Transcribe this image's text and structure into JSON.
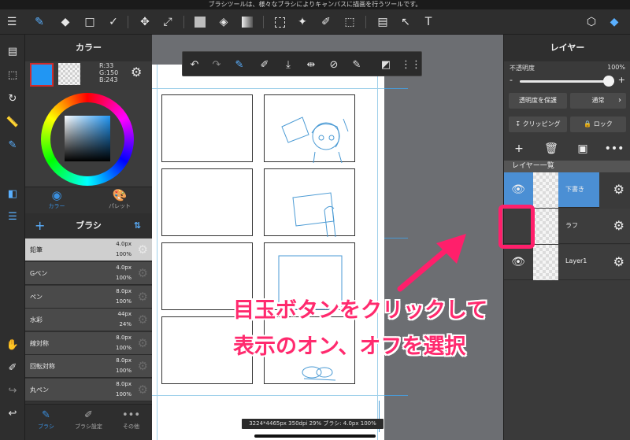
{
  "status_bar": {
    "text": "ブラシツールは、様々なブラシによりキャンバスに描画を行うツールです。"
  },
  "top_toolbar": {
    "tools": [
      "menu-icon",
      "brush-tool-icon",
      "eraser-tool-icon",
      "rectangle-tool-icon",
      "sparkle-tool-icon",
      "move-tool-icon",
      "transform-tool-icon",
      "fill-color-icon",
      "bucket-tool-icon",
      "gradient-tool-icon",
      "select-tool-icon",
      "magic-wand-icon",
      "select-pen-icon",
      "select-eraser-icon",
      "frame-divide-icon",
      "operation-tool-icon",
      "text-tool-icon",
      "material-icon",
      "layer-icon"
    ]
  },
  "color_panel": {
    "title": "カラー",
    "rgb": {
      "r": "R:33",
      "g": "G:150",
      "b": "B:243"
    },
    "main_color": "#2196f3",
    "tabs": [
      {
        "label": "カラー"
      },
      {
        "label": "パレット"
      }
    ]
  },
  "brush_panel": {
    "title": "ブラシ",
    "brushes": [
      {
        "name": "鉛筆",
        "size": "4.0px",
        "opacity": "100%"
      },
      {
        "name": "Gペン",
        "size": "4.0px",
        "opacity": "100%"
      },
      {
        "name": "ペン",
        "size": "8.0px",
        "opacity": "100%"
      },
      {
        "name": "水彩",
        "size": "44px",
        "opacity": "24%"
      },
      {
        "name": "線対称",
        "size": "8.0px",
        "opacity": "100%"
      },
      {
        "name": "回転対称",
        "size": "8.0px",
        "opacity": "100%"
      },
      {
        "name": "丸ペン",
        "size": "8.0px",
        "opacity": "100%"
      }
    ],
    "tabs": [
      {
        "label": "ブラシ"
      },
      {
        "label": "ブラシ設定"
      },
      {
        "label": "その他"
      }
    ]
  },
  "canvas": {
    "info": "3224*4465px 350dpi 29% ブラシ: 4.0px 100%"
  },
  "layer_panel": {
    "title": "レイヤー",
    "opacity_label": "不透明度",
    "opacity_value": "100%",
    "opacity": 1.0,
    "protect_alpha": "透明度を保護",
    "blend_mode": "通常",
    "clipping": "クリッピング",
    "lock": "ロック",
    "list_header": "レイヤー一覧",
    "layers": [
      {
        "name": "下書き",
        "visible": true,
        "selected": true
      },
      {
        "name": "ラフ",
        "visible": false,
        "selected": false
      },
      {
        "name": "Layer1",
        "visible": true,
        "selected": false
      }
    ]
  },
  "annotation": {
    "line1": "目玉ボタンをクリックして",
    "line2": "表示のオン、オフを選択",
    "color": "#ff1f6b"
  }
}
